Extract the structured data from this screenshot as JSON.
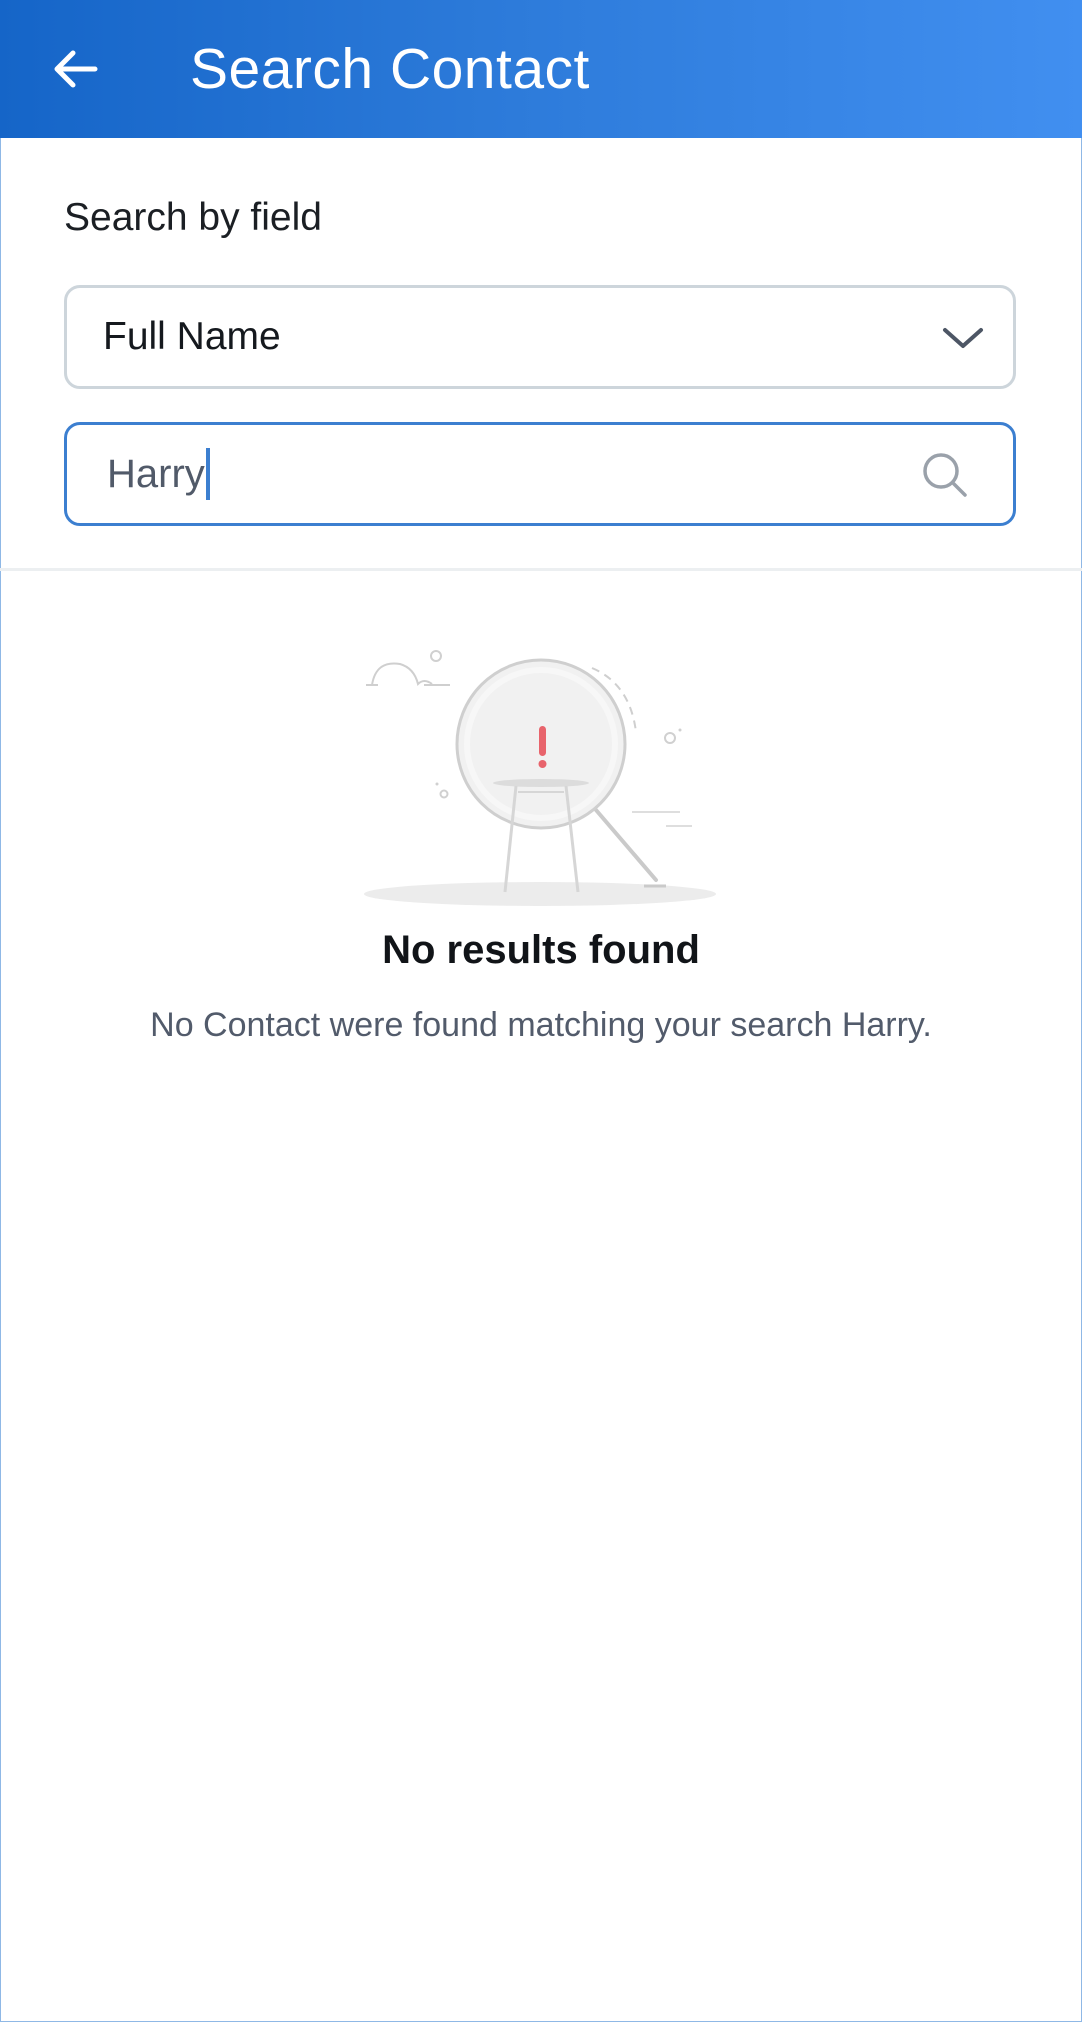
{
  "header": {
    "title": "Search Contact"
  },
  "search_form": {
    "field_label": "Search by field",
    "selected_field": "Full Name",
    "query_value": "Harry"
  },
  "empty_state": {
    "title": "No results found",
    "description": "No Contact were found matching your search Harry."
  },
  "colors": {
    "header_gradient_start": "#1565c8",
    "header_gradient_end": "#418ff0",
    "input_focus_border": "#3c7fd0",
    "illustration_alert": "#e8646c"
  },
  "icons": {
    "back": "arrow-left-icon",
    "dropdown": "chevron-down-icon",
    "search": "search-icon",
    "illustration": "magnifier-alert-illustration"
  }
}
